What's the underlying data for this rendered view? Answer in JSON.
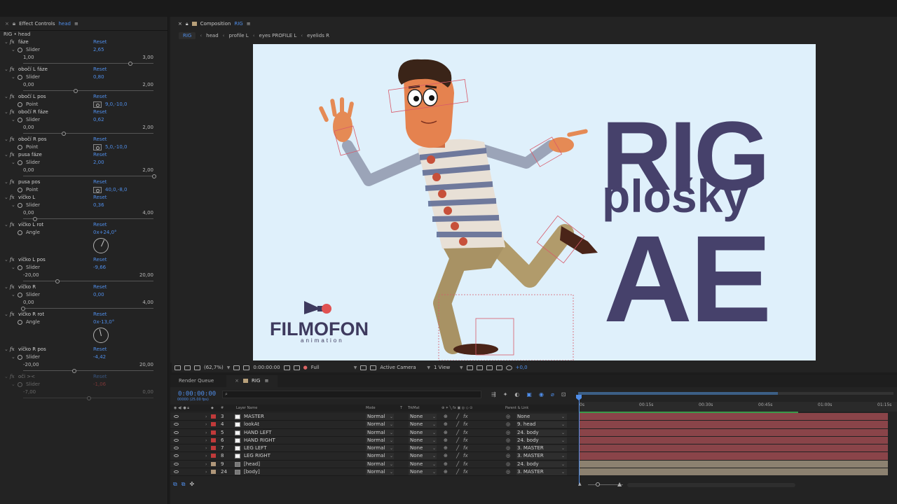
{
  "effect_controls": {
    "tab_title": "Effect Controls",
    "tab_layer": "head",
    "subtitle": "RIG • head",
    "effects": [
      {
        "name": "fáze",
        "reset": "Reset",
        "param": "Slider",
        "value": "2,65",
        "min": "1,00",
        "max": "3,00",
        "pos": 0.82
      },
      {
        "name": "obočí L fáze",
        "reset": "Reset",
        "param": "Slider",
        "value": "0,80",
        "min": "0,00",
        "max": "2,00",
        "pos": 0.4
      },
      {
        "name": "obočí L pos",
        "reset": "Reset",
        "param": "Point",
        "value": "9,0,-10,0"
      },
      {
        "name": "obočí R fáze",
        "reset": "Reset",
        "param": "Slider",
        "value": "0,62",
        "min": "0,00",
        "max": "2,00",
        "pos": 0.31
      },
      {
        "name": "obočí R pos",
        "reset": "Reset",
        "param": "Point",
        "value": "5,0,-10,0"
      },
      {
        "name": "pusa fáze",
        "reset": "Reset",
        "param": "Slider",
        "value": "2,00",
        "min": "0,00",
        "max": "2,00",
        "pos": 1.0
      },
      {
        "name": "pusa pos",
        "reset": "Reset",
        "param": "Point",
        "value": "40,0,-8,0"
      },
      {
        "name": "víčko L",
        "reset": "Reset",
        "param": "Slider",
        "value": "0,36",
        "min": "0,00",
        "max": "4,00",
        "pos": 0.09
      },
      {
        "name": "víčko L rot",
        "reset": "Reset",
        "param": "Angle",
        "value": "0x+24,0°",
        "angle": 24
      },
      {
        "name": "víčko L pos",
        "reset": "Reset",
        "param": "Slider",
        "value": "-9,66",
        "min": "-20,00",
        "max": "20,00",
        "pos": 0.26
      },
      {
        "name": "víčko R",
        "reset": "Reset",
        "param": "Slider",
        "value": "0,00",
        "min": "0,00",
        "max": "4,00",
        "pos": 0.0
      },
      {
        "name": "víčko R rot",
        "reset": "Reset",
        "param": "Angle",
        "value": "0x-13,0°",
        "angle": -13
      },
      {
        "name": "víčko R pos",
        "reset": "Reset",
        "param": "Slider",
        "value": "-4,42",
        "min": "-20,00",
        "max": "20,00",
        "pos": 0.39
      },
      {
        "name": "oči ><",
        "reset": "Reset",
        "param": "Slider",
        "value": "-1,06",
        "min": "-7,00",
        "max": "0,00",
        "pos": 0.5,
        "disabled": true
      }
    ]
  },
  "composition": {
    "tab_title": "Composition",
    "tab_comp": "RIG",
    "breadcrumbs": [
      "RIG",
      "head",
      "profile L",
      "eyes PROFILE L",
      "eyelids R"
    ],
    "artwork": {
      "title_line1": "RIG",
      "title_line2": "plošky",
      "title_line3": "AE",
      "logo": "FILMOFON",
      "logo_sub": "animation",
      "title_color": "#46416b",
      "bg_color": "#dff0fb"
    }
  },
  "viewer_toolbar": {
    "zoom": "(62,7%)",
    "timecode": "0:00:00:00",
    "resolution": "Full",
    "camera": "Active Camera",
    "views": "1 View",
    "exposure": "+0,0"
  },
  "timeline": {
    "tabs": [
      "Render Queue",
      "RIG"
    ],
    "timecode": "0:00:00:00",
    "timecode_sub": "00000 (25.00 fps)",
    "columns": {
      "layer_name": "Layer Name",
      "mode": "Mode",
      "t": "T",
      "trkmat": "TrkMat",
      "parent": "Parent & Link"
    },
    "layers": [
      {
        "num": "3",
        "name": "MASTER",
        "mode": "Normal",
        "trkmat": "None",
        "parent": "None",
        "label_color": "#c03a3a",
        "icon": "solid",
        "bar_color": "#8a4449"
      },
      {
        "num": "4",
        "name": "lookAt",
        "mode": "Normal",
        "trkmat": "None",
        "parent": "9. head",
        "label_color": "#c03a3a",
        "icon": "solid",
        "bar_color": "#8a4449"
      },
      {
        "num": "5",
        "name": "HAND LEFT",
        "mode": "Normal",
        "trkmat": "None",
        "parent": "24. body",
        "label_color": "#c03a3a",
        "icon": "solid",
        "bar_color": "#8a4449"
      },
      {
        "num": "6",
        "name": "HAND RIGHT",
        "mode": "Normal",
        "trkmat": "None",
        "parent": "24. body",
        "label_color": "#c03a3a",
        "icon": "solid",
        "bar_color": "#8a4449"
      },
      {
        "num": "7",
        "name": "LEG LEFT",
        "mode": "Normal",
        "trkmat": "None",
        "parent": "3. MASTER",
        "label_color": "#c03a3a",
        "icon": "solid",
        "bar_color": "#8a4449"
      },
      {
        "num": "8",
        "name": "LEG RIGHT",
        "mode": "Normal",
        "trkmat": "None",
        "parent": "3. MASTER",
        "label_color": "#c03a3a",
        "icon": "solid",
        "bar_color": "#8a4449"
      },
      {
        "num": "9",
        "name": "[head]",
        "mode": "Normal",
        "trkmat": "None",
        "parent": "24. body",
        "label_color": "#b0977a",
        "icon": "comp",
        "bar_color": "#8c8170"
      },
      {
        "num": "24",
        "name": "[body]",
        "mode": "Normal",
        "trkmat": "None",
        "parent": "3. MASTER",
        "label_color": "#b0977a",
        "icon": "comp",
        "bar_color": "#8c8170"
      }
    ],
    "ruler": [
      "0s",
      "00:15s",
      "00:30s",
      "00:45s",
      "01:00s",
      "01:15s"
    ]
  }
}
